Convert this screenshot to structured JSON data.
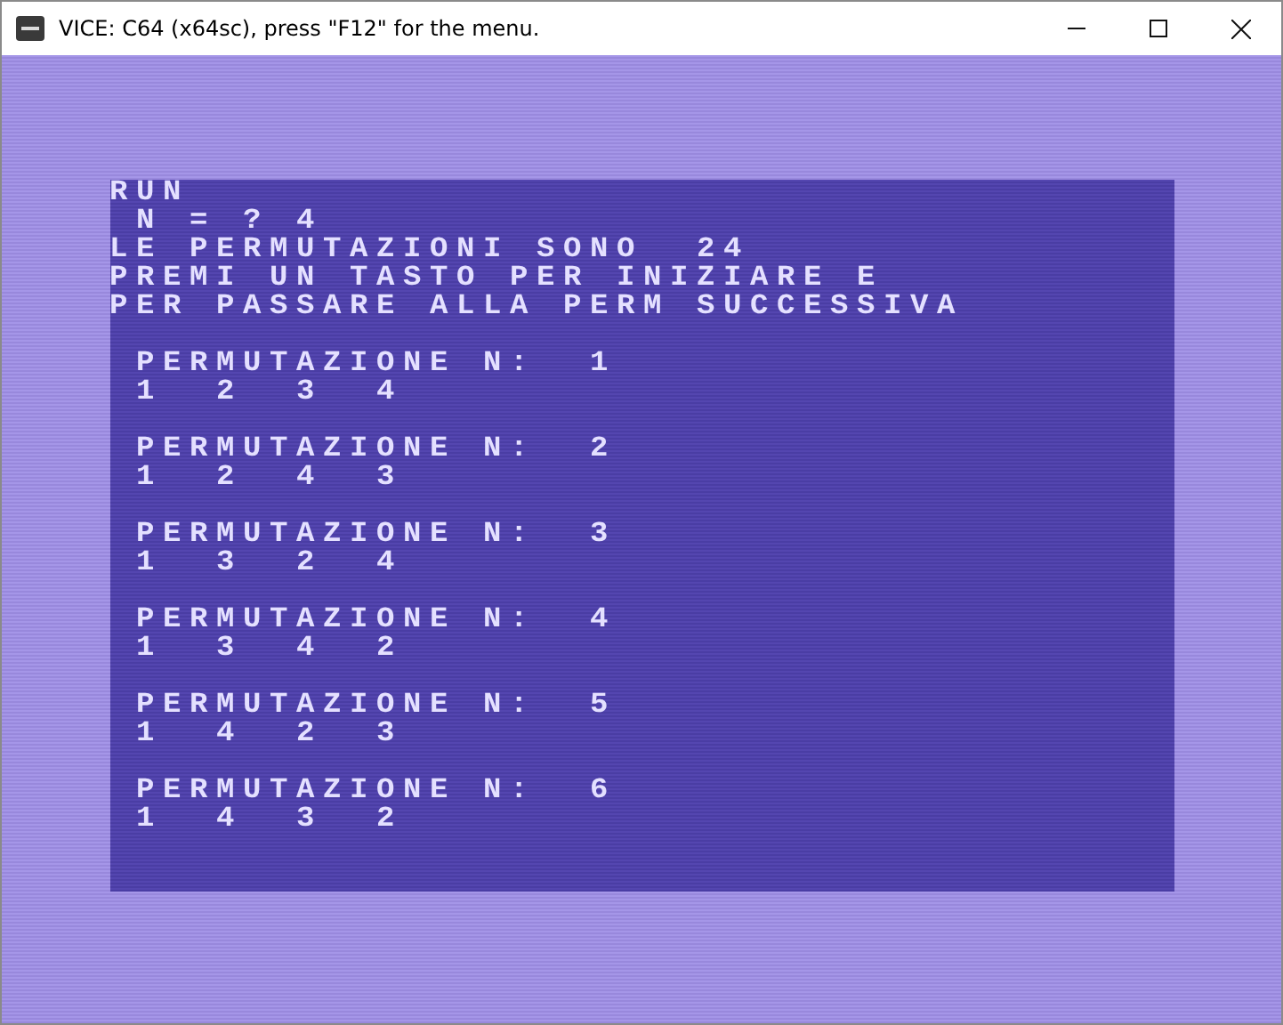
{
  "window": {
    "title": "VICE: C64 (x64sc), press \"F12\" for the menu."
  },
  "screen": {
    "header_lines": [
      "RUN",
      " N = ? 4",
      "LE PERMUTAZIONI SONO  24",
      "PREMI UN TASTO PER INIZIARE E",
      "PER PASSARE ALLA PERM SUCCESSIVA"
    ],
    "permutations": [
      {
        "heading": " PERMUTAZIONE N:  1",
        "values": " 1  2  3  4"
      },
      {
        "heading": " PERMUTAZIONE N:  2",
        "values": " 1  2  4  3"
      },
      {
        "heading": " PERMUTAZIONE N:  3",
        "values": " 1  3  2  4"
      },
      {
        "heading": " PERMUTAZIONE N:  4",
        "values": " 1  3  4  2"
      },
      {
        "heading": " PERMUTAZIONE N:  5",
        "values": " 1  4  2  3"
      },
      {
        "heading": " PERMUTAZIONE N:  6",
        "values": " 1  4  3  2"
      }
    ]
  }
}
